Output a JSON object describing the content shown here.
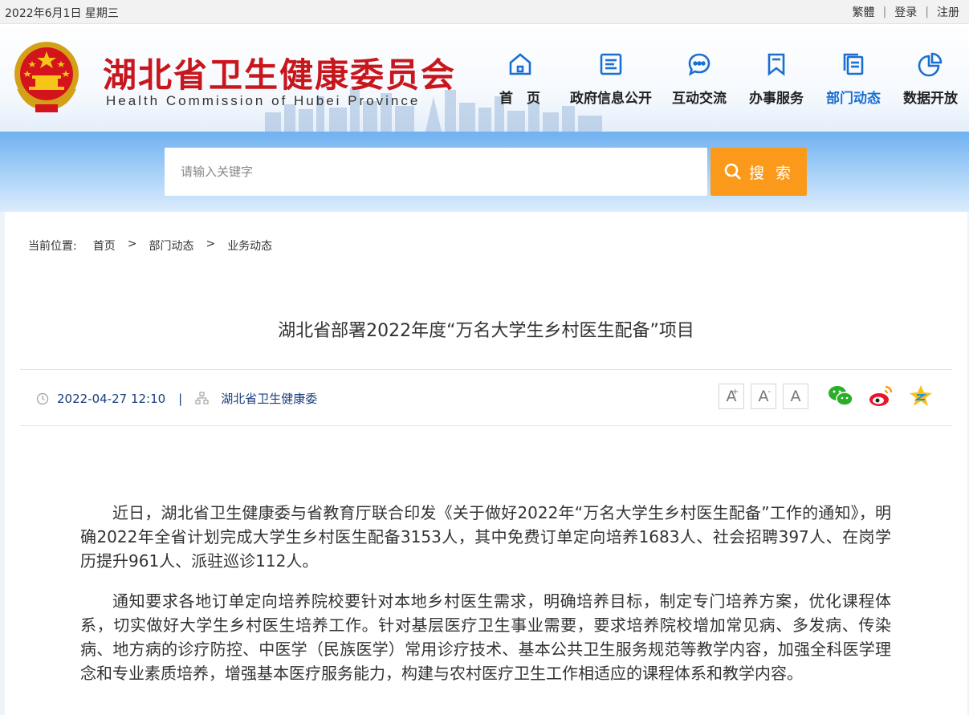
{
  "topbar": {
    "date": "2022年6月1日 星期三",
    "links": [
      "繁體",
      "登录",
      "注册"
    ]
  },
  "header": {
    "title": "湖北省卫生健康委员会",
    "subtitle": "Health Commission of Hubei Province",
    "nav": [
      {
        "label": "首　页",
        "icon": "home-icon"
      },
      {
        "label": "政府信息公开",
        "icon": "document-icon"
      },
      {
        "label": "互动交流",
        "icon": "chat-icon"
      },
      {
        "label": "办事服务",
        "icon": "bookmark-icon"
      },
      {
        "label": "部门动态",
        "icon": "files-icon",
        "active": true
      },
      {
        "label": "数据开放",
        "icon": "pie-chart-icon"
      }
    ]
  },
  "search": {
    "placeholder": "请输入关键字",
    "button_label": "搜 索"
  },
  "breadcrumb": {
    "label": "当前位置:",
    "items": [
      "首页",
      "部门动态",
      "业务动态"
    ],
    "separator": ">"
  },
  "article": {
    "title": "湖北省部署2022年度“万名大学生乡村医生配备”项目",
    "datetime": "2022-04-27 12:10",
    "source": "湖北省卫生健康委",
    "paragraphs": [
      "近日，湖北省卫生健康委与省教育厅联合印发《关于做好2022年“万名大学生乡村医生配备”工作的通知》，明确2022年全省计划完成大学生乡村医生配备3153人，其中免费订单定向培养1683人、社会招聘397人、在岗学历提升961人、派驻巡诊112人。",
      "通知要求各地订单定向培养院校要针对本地乡村医生需求，明确培养目标，制定专门培养方案，优化课程体系，切实做好大学生乡村医生培养工作。针对基层医疗卫生事业需要，要求培养院校增加常见病、多发病、传染病、地方病的诊疗防控、中医学（民族医学）常用诊疗技术、基本公共卫生服务规范等教学内容，加强全科医学理念和专业素质培养，增强基本医疗服务能力，构建与农村医疗卫生工作相适应的课程体系和教学内容。"
    ]
  },
  "font_buttons": {
    "larger": "A",
    "larger_mark": "+",
    "smaller": "A",
    "smaller_mark": "-",
    "reset": "A"
  },
  "colors": {
    "brand_red": "#c8161d",
    "nav_blue": "#1a6fd0",
    "search_orange": "#fb9a1a"
  }
}
